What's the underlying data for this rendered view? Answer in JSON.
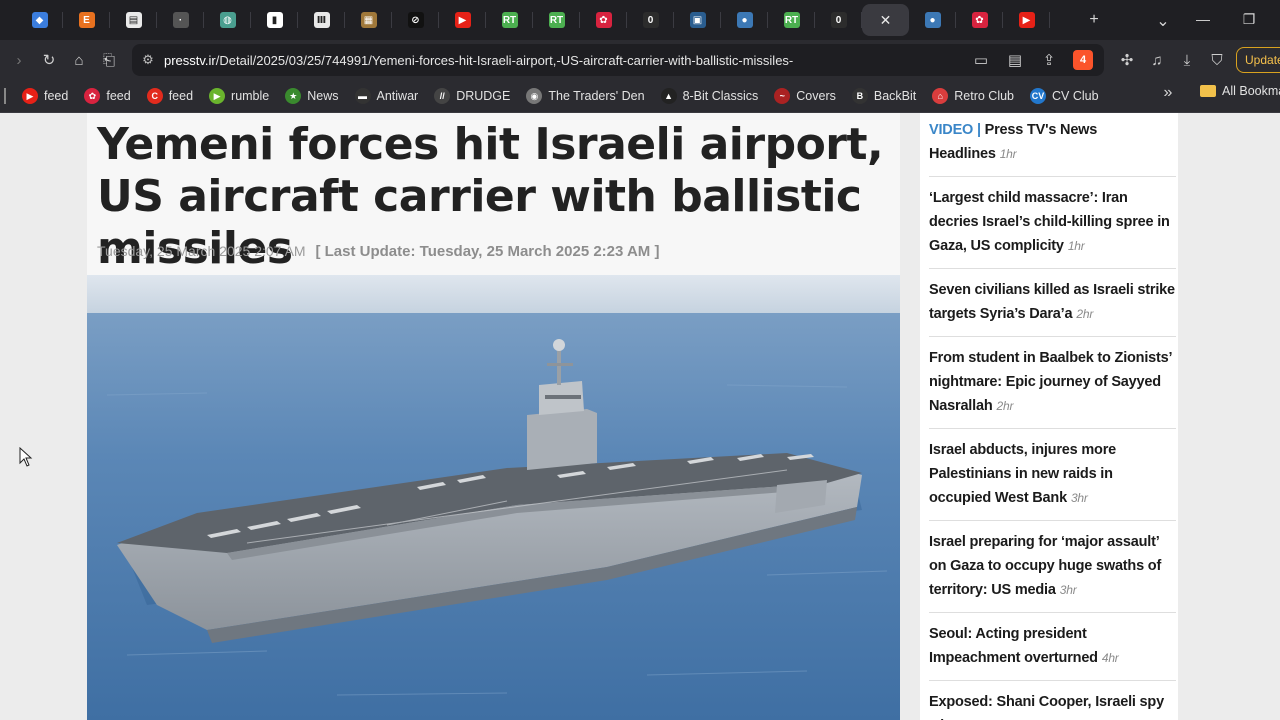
{
  "tabs": [
    {
      "name": "tab-1",
      "icon": "cube-icon",
      "color": "#3b7ddd",
      "glyph": "◆"
    },
    {
      "name": "tab-2",
      "icon": "e-icon",
      "color": "#e8711f",
      "glyph": "E"
    },
    {
      "name": "tab-3",
      "icon": "newspaper-icon",
      "color": "#eaeaea",
      "glyph": "▤"
    },
    {
      "name": "tab-4",
      "icon": "dots-icon",
      "color": "#555555",
      "glyph": "·"
    },
    {
      "name": "tab-5",
      "icon": "globe-icon",
      "color": "#4a9e8f",
      "glyph": "◍"
    },
    {
      "name": "tab-6",
      "icon": "doc-icon",
      "color": "#ffffff",
      "glyph": "▮"
    },
    {
      "name": "tab-7",
      "icon": "pillar-icon",
      "color": "#e8e8e8",
      "glyph": "Ⅲ"
    },
    {
      "name": "tab-8",
      "icon": "image-icon",
      "color": "#a0783a",
      "glyph": "▦"
    },
    {
      "name": "tab-9",
      "icon": "circle-slash-icon",
      "color": "#111111",
      "glyph": "⊘"
    },
    {
      "name": "tab-10",
      "icon": "youtube-icon",
      "color": "#e62117",
      "glyph": "▶"
    },
    {
      "name": "tab-11",
      "icon": "rt-icon",
      "color": "#4caf50",
      "glyph": "RT"
    },
    {
      "name": "tab-12",
      "icon": "rt-icon",
      "color": "#4caf50",
      "glyph": "RT"
    },
    {
      "name": "tab-13",
      "icon": "raspberry-icon",
      "color": "#d8233f",
      "glyph": "✿"
    },
    {
      "name": "tab-14",
      "icon": "ring-icon",
      "color": "#2c2c2c",
      "glyph": "0"
    },
    {
      "name": "tab-15",
      "icon": "book-icon",
      "color": "#2a5d8f",
      "glyph": "▣"
    },
    {
      "name": "tab-16",
      "icon": "person-icon",
      "color": "#3c78b5",
      "glyph": "●"
    },
    {
      "name": "tab-17",
      "icon": "rt-icon",
      "color": "#4caf50",
      "glyph": "RT"
    },
    {
      "name": "tab-18",
      "icon": "ring-icon",
      "color": "#2c2c2c",
      "glyph": "0"
    },
    {
      "name": "tab-19",
      "icon": "close-icon",
      "active": true
    },
    {
      "name": "tab-20",
      "icon": "person-icon",
      "color": "#3c78b5",
      "glyph": "●"
    },
    {
      "name": "tab-21",
      "icon": "raspberry-icon",
      "color": "#d8233f",
      "glyph": "✿"
    },
    {
      "name": "tab-22",
      "icon": "youtube-icon",
      "color": "#e62117",
      "glyph": "▶"
    }
  ],
  "toolbar": {
    "url_host": "presstv.ir",
    "url_path": "/Detail/2025/03/25/744991/Yemeni-forces-hit-Israeli-airport,-US-aircraft-carrier-with-ballistic-missiles-",
    "update_label": "Update",
    "brave_badge": "4"
  },
  "bookmarks": [
    {
      "name": "bookmark-feed-youtube",
      "label": "feed",
      "icon": "youtube-icon",
      "color": "#e62117",
      "glyph": "▶"
    },
    {
      "name": "bookmark-feed-raspberry",
      "label": "feed",
      "icon": "raspberry-icon",
      "color": "#d8233f",
      "glyph": "✿"
    },
    {
      "name": "bookmark-feed-c",
      "label": "feed",
      "icon": "c-icon",
      "color": "#e22b1d",
      "glyph": "C"
    },
    {
      "name": "bookmark-rumble",
      "label": "rumble",
      "icon": "rumble-icon",
      "color": "#6ab42d",
      "glyph": "▶"
    },
    {
      "name": "bookmark-news",
      "label": "News",
      "icon": "star-icon",
      "color": "#3a8a2e",
      "glyph": "★"
    },
    {
      "name": "bookmark-antiwar",
      "label": "Antiwar",
      "icon": "antiwar-icon",
      "color": "#333333",
      "glyph": "▬"
    },
    {
      "name": "bookmark-drudge",
      "label": "DRUDGE",
      "icon": "drudge-icon",
      "color": "#444444",
      "glyph": "//"
    },
    {
      "name": "bookmark-traders-den",
      "label": "The Traders' Den",
      "icon": "traders-icon",
      "color": "#777777",
      "glyph": "◉"
    },
    {
      "name": "bookmark-8bit-classics",
      "label": "8-Bit Classics",
      "icon": "game-icon",
      "color": "#222222",
      "glyph": "▲"
    },
    {
      "name": "bookmark-covers",
      "label": "Covers",
      "icon": "covers-icon",
      "color": "#aa2222",
      "glyph": "~"
    },
    {
      "name": "bookmark-backbit",
      "label": "BackBit",
      "icon": "backbit-icon",
      "color": "#333333",
      "glyph": "B"
    },
    {
      "name": "bookmark-retro-club",
      "label": "Retro Club",
      "icon": "retro-icon",
      "color": "#d93d3d",
      "glyph": "⌂"
    },
    {
      "name": "bookmark-cv-club",
      "label": "CV Club",
      "icon": "cv-icon",
      "color": "#2277cc",
      "glyph": "CV"
    }
  ],
  "bookmarks_all_label": "All Bookmarks",
  "article": {
    "headline": "Yemeni forces hit Israeli airport, US aircraft carrier with ballistic missiles",
    "date": "Tuesday, 25 March 2025 2:07 AM",
    "last_update": "[ Last Update: Tuesday, 25 March 2025 2:23 AM ]"
  },
  "sidebar": {
    "items": [
      {
        "tag": "VIDEO | ",
        "title": "Press TV's News Headlines",
        "time": "1hr"
      },
      {
        "tag": "",
        "title": "‘Largest child massacre’: Iran decries Israel’s child-killing spree in Gaza, US complicity",
        "time": "1hr"
      },
      {
        "tag": "",
        "title": "Seven civilians killed as Israeli strike targets Syria’s Dara’a",
        "time": "2hr"
      },
      {
        "tag": "",
        "title": "From student in Baalbek to Zionists’ nightmare: Epic journey of Sayyed Nasrallah",
        "time": "2hr"
      },
      {
        "tag": "",
        "title": "Israel abducts, injures more Palestinians in new raids in occupied West Bank",
        "time": "3hr"
      },
      {
        "tag": "",
        "title": "Israel preparing for ‘major assault’ on Gaza to occupy huge swaths of territory: US media",
        "time": "3hr"
      },
      {
        "tag": "",
        "title": "Seoul: Acting president Impeachment overturned",
        "time": "4hr"
      },
      {
        "tag": "",
        "title": "Exposed: Shani Cooper, Israeli spy who",
        "time": ""
      }
    ]
  }
}
